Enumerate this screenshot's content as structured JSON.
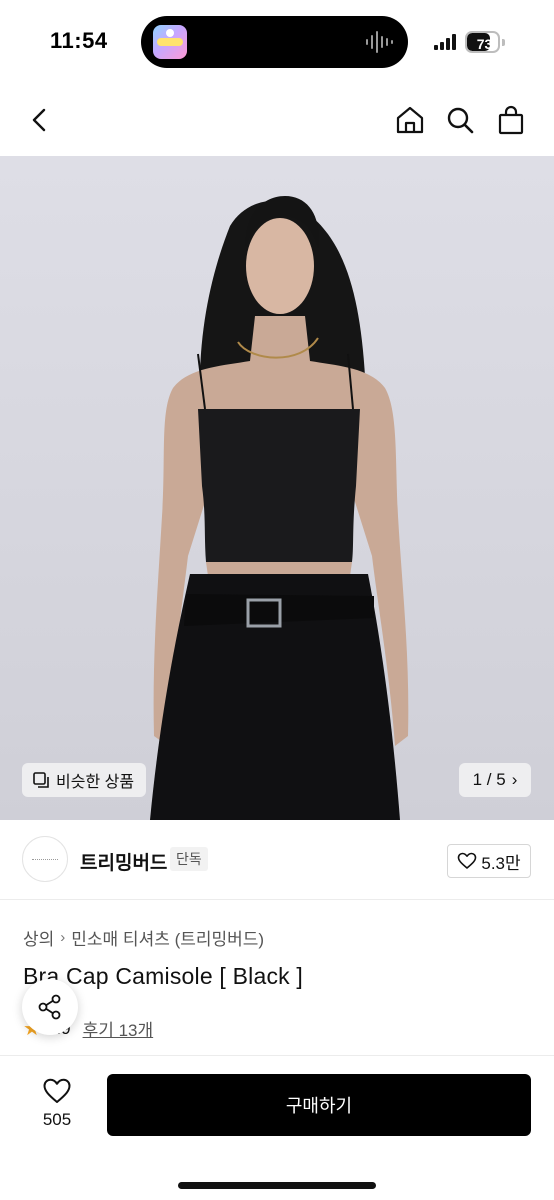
{
  "status_bar": {
    "time": "11:54",
    "battery": "73",
    "battery_level": 0.73
  },
  "nav": {
    "back_icon": "chevron-left-icon",
    "home_icon": "home-icon",
    "search_icon": "search-icon",
    "bag_icon": "shopping-bag-icon"
  },
  "gallery": {
    "similar_label": "비슷한 상품",
    "pager_text": "1 / 5",
    "pager_arrow": "›"
  },
  "brand": {
    "name": "트리밍버드",
    "badge": "단독",
    "likes": "5.3만"
  },
  "product": {
    "category": "상의",
    "subcategory": "민소매 티셔츠 (트리밍버드)",
    "title": "Bra Cap Camisole [ Black ]",
    "rating": "4.9",
    "reviews": "후기 13개"
  },
  "bottom": {
    "wish_count": "505",
    "buy_label": "구매하기"
  },
  "colors": {
    "accent": "#000000",
    "star": "#f5a623"
  }
}
